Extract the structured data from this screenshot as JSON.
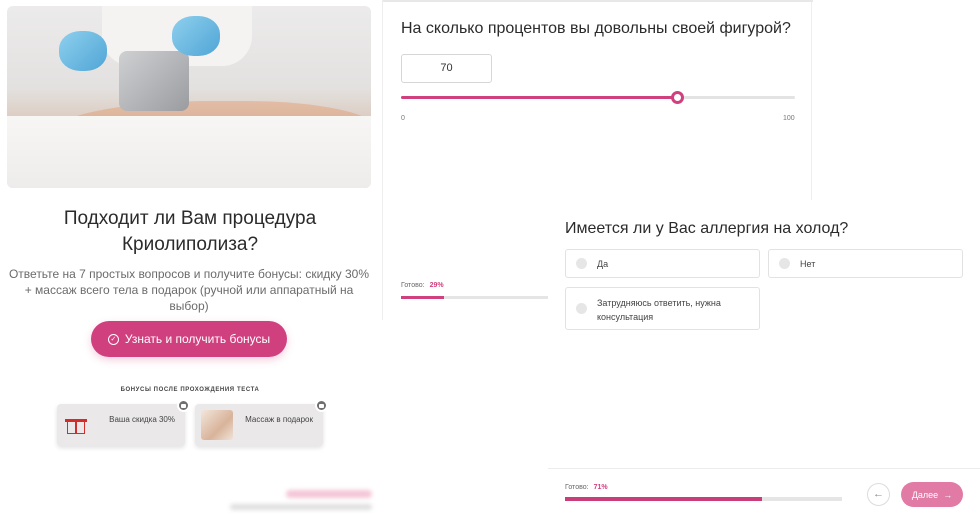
{
  "landing": {
    "title": "Подходит ли Вам процедура Криолиполиза?",
    "subtitle": "Ответьте на 7 простых вопросов и получите бонусы: скидку 30% + массаж всего тела в подарок (ручной или аппаратный на выбор)",
    "cta_label": "Узнать и получить бонусы",
    "bonus_caption": "БОНУСЫ ПОСЛЕ ПРОХОЖДЕНИЯ ТЕСТА",
    "bonuses": [
      {
        "label": "Ваша скидка 30%",
        "icon": "gift-icon",
        "locked": true
      },
      {
        "label": "Массаж в подарок",
        "icon": "massage-photo",
        "locked": true
      }
    ]
  },
  "quiz_step_1": {
    "question": "На сколько процентов вы довольны своей фигурой?",
    "input_value": "70",
    "slider": {
      "min": 0,
      "max": 100,
      "value": 70,
      "min_label": "0",
      "max_label": "100"
    },
    "progress": {
      "label": "Готово:",
      "percent_text": "29%",
      "fraction": 0.29
    }
  },
  "quiz_step_2": {
    "question": "Имеется ли у Вас аллергия на холод?",
    "options": [
      "Да",
      "Нет",
      "Затрудняюсь ответить, нужна консультация"
    ],
    "progress": {
      "label": "Готово:",
      "percent_text": "71%",
      "fraction": 0.71
    },
    "next_label": "Далее"
  },
  "colors": {
    "accent": "#d0407f",
    "next_button": "#e27aa6"
  }
}
